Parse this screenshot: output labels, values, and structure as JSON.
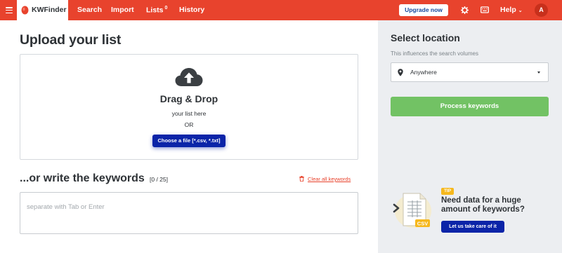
{
  "header": {
    "brand": "KWFinder",
    "nav": {
      "search": "Search",
      "import": "Import",
      "lists": "Lists",
      "lists_count": "0",
      "history": "History"
    },
    "upgrade_label": "Upgrade now",
    "help_label": "Help",
    "avatar_initial": "A"
  },
  "upload": {
    "title": "Upload your list",
    "drag_title": "Drag & Drop",
    "drag_sub": "your list here",
    "or": "OR",
    "choose_label": "Choose a file [*.csv, *.txt]"
  },
  "keywords": {
    "title": "...or write the keywords",
    "counter": "[0 / 25]",
    "clear_label": "Clear all keywords",
    "placeholder": "separate with Tab or Enter"
  },
  "location": {
    "title": "Select location",
    "subtitle": "This influences the search volumes",
    "selected": "Anywhere",
    "process_label": "Process keywords"
  },
  "tip": {
    "badge": "TIP",
    "text": "Need data for a huge amount of keywords?",
    "cta": "Let us take care of it",
    "file_label": "CSV"
  },
  "colors": {
    "brand": "#e8432d",
    "primary_blue": "#0b24a8",
    "green": "#72c264",
    "panel_bg": "#eceef1",
    "tip_yellow": "#f6b81d"
  },
  "icons": [
    "menu-icon",
    "kwfinder-logo-icon",
    "settings-icon",
    "keyboard-icon",
    "chevron-down-icon",
    "upload-cloud-icon",
    "trash-icon",
    "location-pin-icon",
    "csv-file-icon"
  ]
}
